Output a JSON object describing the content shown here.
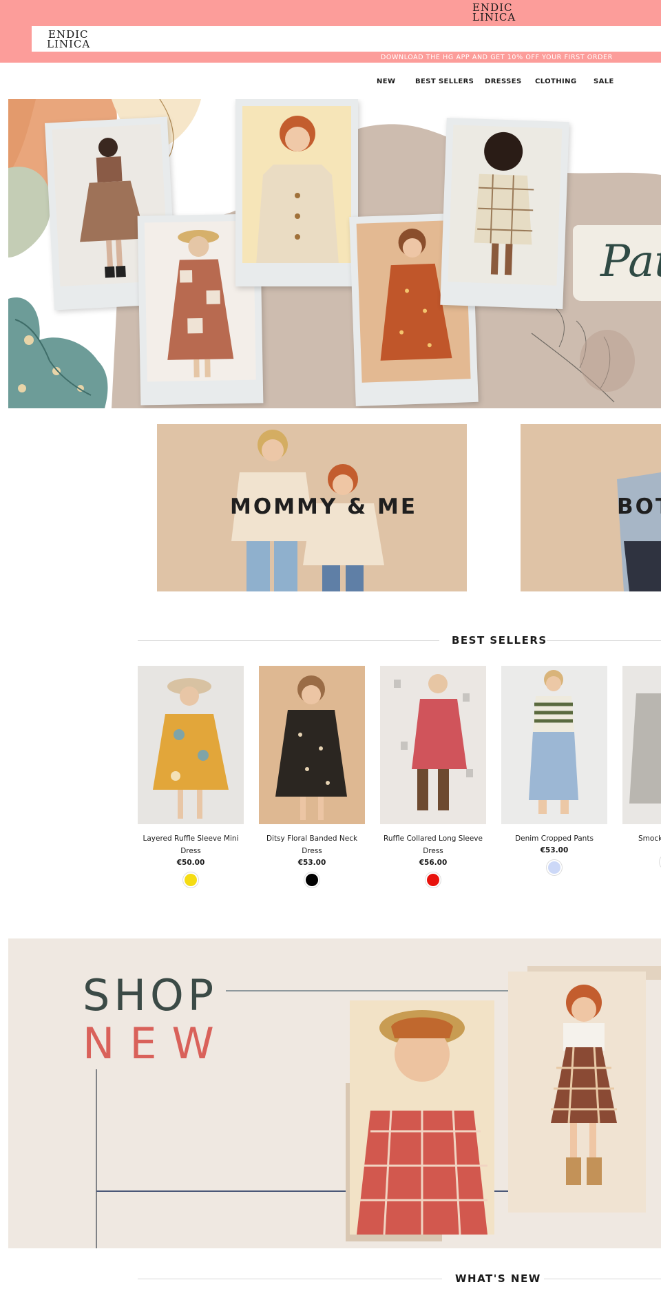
{
  "header": {
    "logo_top_line1": "ENDIC",
    "logo_top_line2": "LINICA",
    "logo_line1": "ENDIC",
    "logo_line2": "LINICA",
    "promo_text": "DOWNLOAD THE HG APP AND GET 10% OFF YOUR FIRST ORDER",
    "brand_color": "#fc9d9a"
  },
  "nav": {
    "items": [
      {
        "label": "NEW"
      },
      {
        "label": "BEST SELLERS"
      },
      {
        "label": "DRESSES"
      },
      {
        "label": "CLOTHING"
      },
      {
        "label": "SALE"
      }
    ]
  },
  "hero": {
    "script_text": "Pat"
  },
  "categories": [
    {
      "title": "MOMMY & ME"
    },
    {
      "title": "BOT"
    }
  ],
  "best_sellers": {
    "title": "BEST SELLERS",
    "products": [
      {
        "name": "Layered Ruffle Sleeve Mini Dress",
        "price": "€50.00",
        "swatch": "#f5dc14"
      },
      {
        "name": "Ditsy Floral Banded Neck Dress",
        "price": "€53.00",
        "swatch": "#000000"
      },
      {
        "name": "Ruffle Collared Long Sleeve Dress",
        "price": "€56.00",
        "swatch": "#e8120c"
      },
      {
        "name": "Denim Cropped Pants",
        "price": "€53.00",
        "swatch": "#ccd8f7"
      },
      {
        "name": "Smock",
        "price": "",
        "swatch": "#e8b7b4"
      }
    ]
  },
  "shop_new": {
    "line1": "SHOP",
    "line2": "NEW",
    "accent_color": "#d9615a"
  },
  "whats_new": {
    "title": "WHAT'S NEW"
  }
}
